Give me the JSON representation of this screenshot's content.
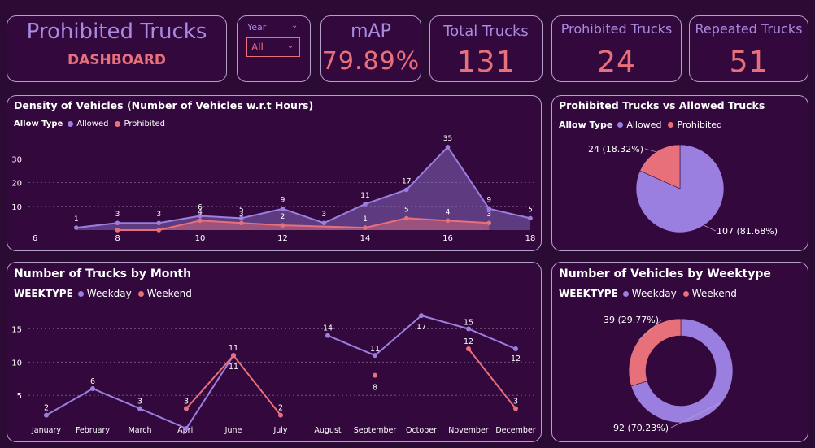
{
  "colors": {
    "allowed": "#9b7fe0",
    "prohibited": "#e8707a",
    "accent": "#a98ae0",
    "background": "#2b0a33"
  },
  "header": {
    "title": "Prohibited Trucks",
    "subtitle": "DASHBOARD"
  },
  "filter": {
    "label": "Year",
    "value": "All",
    "icon": "chevron-down-icon"
  },
  "kpis": {
    "map": {
      "label": "mAP",
      "value": "79.89%"
    },
    "total": {
      "label": "Total Trucks",
      "value": "131"
    },
    "prohibited": {
      "label": "Prohibited Trucks",
      "value": "24"
    },
    "repeated": {
      "label": "Repeated Trucks",
      "value": "51"
    }
  },
  "chart_data": [
    {
      "type": "area",
      "title": "Density of Vehicles (Number of Vehicles w.r.t Hours)",
      "legend_title": "Allow Type",
      "legend_position": "top-left",
      "grid": true,
      "ylim": [
        0,
        37
      ],
      "y_ticks": [
        10,
        20,
        30
      ],
      "x_ticks": [
        6,
        8,
        10,
        12,
        14,
        16,
        18
      ],
      "series": [
        {
          "name": "Allowed",
          "x": [
            7,
            8,
            9,
            10,
            11,
            12,
            13,
            14,
            15,
            16,
            17,
            18
          ],
          "values": [
            1,
            3,
            3,
            6,
            5,
            9,
            3,
            11,
            17,
            35,
            9,
            5
          ]
        },
        {
          "name": "Prohibited",
          "x": [
            8,
            9,
            10,
            11,
            12,
            14,
            15,
            16,
            17
          ],
          "values": [
            0,
            0,
            4,
            3,
            2,
            1,
            5,
            4,
            3
          ]
        }
      ]
    },
    {
      "type": "pie",
      "title": "Prohibited Trucks vs Allowed Trucks",
      "legend_title": "Allow Type",
      "legend_position": "top-left",
      "slices": [
        {
          "name": "Allowed",
          "value": 107,
          "label": "107 (81.68%)"
        },
        {
          "name": "Prohibited",
          "value": 24,
          "label": "24 (18.32%)"
        }
      ]
    },
    {
      "type": "line",
      "title": "Number of Trucks by Month",
      "legend_title": "WEEKTYPE",
      "legend_position": "top-left",
      "grid": true,
      "ylim": [
        0,
        18
      ],
      "y_ticks": [
        5,
        10,
        15
      ],
      "categories": [
        "January",
        "February",
        "March",
        "April",
        "June",
        "July",
        "August",
        "September",
        "October",
        "November",
        "December"
      ],
      "series": [
        {
          "name": "Weekday",
          "values": [
            2,
            6,
            3,
            0,
            11,
            null,
            14,
            11,
            17,
            15,
            12
          ]
        },
        {
          "name": "Weekend",
          "values": [
            null,
            null,
            null,
            3,
            11,
            2,
            null,
            8,
            null,
            12,
            3
          ]
        }
      ]
    },
    {
      "type": "pie",
      "title": "Number of Vehicles by Weektype",
      "legend_title": "WEEKTYPE",
      "legend_position": "top-left",
      "donut": true,
      "slices": [
        {
          "name": "Weekday",
          "value": 92,
          "label": "92 (70.23%)"
        },
        {
          "name": "Weekend",
          "value": 39,
          "label": "39 (29.77%)"
        }
      ]
    }
  ]
}
